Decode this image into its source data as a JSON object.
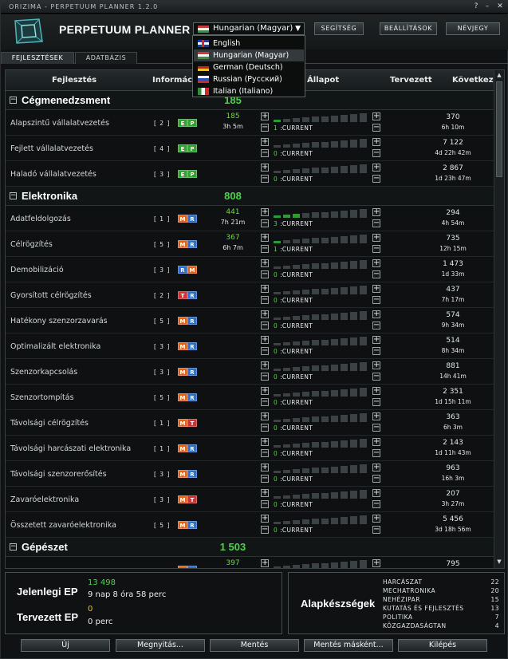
{
  "window": {
    "title": "ORIZIMA - PERPETUUM PLANNER 1.2.0",
    "help": "?",
    "minimize": "–",
    "close": "✕"
  },
  "app": {
    "title": "PERPETUUM PLANNER"
  },
  "language": {
    "selected": "Hungarian (Magyar)",
    "options": [
      "English",
      "Hungarian (Magyar)",
      "German (Deutsch)",
      "Russian (Русский)",
      "Italian (Italiano)"
    ]
  },
  "header_buttons": [
    "SEGÍTSÉG",
    "BEÁLLÍTÁSOK",
    "NÉVJEGY"
  ],
  "tabs": [
    "FEJLESZTÉSEK",
    "ADATBÁZIS"
  ],
  "columns": {
    "name": "Fejlesztés",
    "info": "Informác",
    "state": "Állapot",
    "planned": "Tervezett",
    "next": "Következő"
  },
  "categories": [
    {
      "name": "Cégmenedzsment",
      "ep": "185",
      "rows": [
        {
          "name": "Alapszintű vállalatvezetés",
          "level": "[ 2 ]",
          "badges": [
            "E",
            "P"
          ],
          "ep": "185",
          "eptime": "3h 5m",
          "current": "1",
          "current_label": ":CURRENT",
          "filled": 1,
          "next": "370",
          "next_time": "6h 10m"
        },
        {
          "name": "Fejlett vállalatvezetés",
          "level": "[ 4 ]",
          "badges": [
            "E",
            "P"
          ],
          "ep": "",
          "eptime": "",
          "current": "0",
          "current_label": ":CURRENT",
          "filled": 0,
          "next": "7 122",
          "next_time": "4d 22h 42m"
        },
        {
          "name": "Haladó vállalatvezetés",
          "level": "[ 3 ]",
          "badges": [
            "E",
            "P"
          ],
          "ep": "",
          "eptime": "",
          "current": "0",
          "current_label": ":CURRENT",
          "filled": 0,
          "next": "2 867",
          "next_time": "1d 23h 47m"
        }
      ]
    },
    {
      "name": "Elektronika",
      "ep": "808",
      "rows": [
        {
          "name": "Adatfeldolgozás",
          "level": "[ 1 ]",
          "badges": [
            "M",
            "R"
          ],
          "ep": "441",
          "eptime": "7h 21m",
          "current": "3",
          "current_label": ":CURRENT",
          "filled": 3,
          "next": "294",
          "next_time": "4h 54m"
        },
        {
          "name": "Célrögzítés",
          "level": "[ 5 ]",
          "badges": [
            "M",
            "R"
          ],
          "ep": "367",
          "eptime": "6h 7m",
          "current": "1",
          "current_label": ":CURRENT",
          "filled": 1,
          "next": "735",
          "next_time": "12h 15m"
        },
        {
          "name": "Demobilizáció",
          "level": "[ 3 ]",
          "badges": [
            "R",
            "M"
          ],
          "ep": "",
          "eptime": "",
          "current": "0",
          "current_label": ":CURRENT",
          "filled": 0,
          "next": "1 473",
          "next_time": "1d 33m"
        },
        {
          "name": "Gyorsított célrögzítés",
          "level": "[ 2 ]",
          "badges": [
            "T",
            "R"
          ],
          "ep": "",
          "eptime": "",
          "current": "0",
          "current_label": ":CURRENT",
          "filled": 0,
          "next": "437",
          "next_time": "7h 17m"
        },
        {
          "name": "Hatékony szenzorzavarás",
          "level": "[ 5 ]",
          "badges": [
            "M",
            "R"
          ],
          "ep": "",
          "eptime": "",
          "current": "0",
          "current_label": ":CURRENT",
          "filled": 0,
          "next": "574",
          "next_time": "9h 34m"
        },
        {
          "name": "Optimalizált elektronika",
          "level": "[ 3 ]",
          "badges": [
            "M",
            "R"
          ],
          "ep": "",
          "eptime": "",
          "current": "0",
          "current_label": ":CURRENT",
          "filled": 0,
          "next": "514",
          "next_time": "8h 34m"
        },
        {
          "name": "Szenzorkapcsolás",
          "level": "[ 3 ]",
          "badges": [
            "M",
            "R"
          ],
          "ep": "",
          "eptime": "",
          "current": "0",
          "current_label": ":CURRENT",
          "filled": 0,
          "next": "881",
          "next_time": "14h 41m"
        },
        {
          "name": "Szenzortompítás",
          "level": "[ 5 ]",
          "badges": [
            "M",
            "R"
          ],
          "ep": "",
          "eptime": "",
          "current": "0",
          "current_label": ":CURRENT",
          "filled": 0,
          "next": "2 351",
          "next_time": "1d 15h 11m"
        },
        {
          "name": "Távolsági célrögzítés",
          "level": "[ 1 ]",
          "badges": [
            "M",
            "T"
          ],
          "ep": "",
          "eptime": "",
          "current": "0",
          "current_label": ":CURRENT",
          "filled": 0,
          "next": "363",
          "next_time": "6h 3m"
        },
        {
          "name": "Távolsági harcászati elektronika",
          "level": "[ 1 ]",
          "badges": [
            "M",
            "R"
          ],
          "ep": "",
          "eptime": "",
          "current": "0",
          "current_label": ":CURRENT",
          "filled": 0,
          "next": "2 143",
          "next_time": "1d 11h 43m"
        },
        {
          "name": "Távolsági szenzorerősítés",
          "level": "[ 3 ]",
          "badges": [
            "M",
            "R"
          ],
          "ep": "",
          "eptime": "",
          "current": "0",
          "current_label": ":CURRENT",
          "filled": 0,
          "next": "963",
          "next_time": "16h 3m"
        },
        {
          "name": "Zavaróelektronika",
          "level": "[ 3 ]",
          "badges": [
            "M",
            "T"
          ],
          "ep": "",
          "eptime": "",
          "current": "0",
          "current_label": ":CURRENT",
          "filled": 0,
          "next": "207",
          "next_time": "3h 27m"
        },
        {
          "name": "Összetett zavaróelektronika",
          "level": "[ 5 ]",
          "badges": [
            "M",
            "R"
          ],
          "ep": "",
          "eptime": "",
          "current": "0",
          "current_label": ":CURRENT",
          "filled": 0,
          "next": "5 456",
          "next_time": "3d 18h 56m"
        }
      ]
    },
    {
      "name": "Gépészet",
      "ep": "1 503",
      "rows": [
        {
          "name": "",
          "level": "",
          "badges": [
            "M",
            "R"
          ],
          "ep": "397",
          "eptime": "",
          "current": "",
          "current_label": "",
          "filled": 0,
          "next": "795",
          "next_time": ""
        }
      ]
    }
  ],
  "badge_colors": {
    "E": "#2fa52f",
    "P": "#2fa52f",
    "M": "#e0641c",
    "R": "#2b6fcf",
    "T": "#d03232"
  },
  "summary": {
    "current_label": "Jelenlegi EP",
    "current_value": "13 498",
    "current_time": "9 nap 8 óra 58 perc",
    "planned_label": "Tervezett EP",
    "planned_value": "0",
    "planned_time": "0 perc"
  },
  "skills": {
    "title": "Alapkészségek",
    "items": [
      {
        "name": "HARCÁSZAT",
        "count": "22"
      },
      {
        "name": "MECHATRONIKA",
        "count": "20"
      },
      {
        "name": "NEHÉZIPAR",
        "count": "15"
      },
      {
        "name": "KUTATÁS ÉS FEJLESZTÉS",
        "count": "13"
      },
      {
        "name": "POLITIKA",
        "count": "7"
      },
      {
        "name": "KÖZGAZDASÁGTAN",
        "count": "4"
      }
    ]
  },
  "footer_buttons": [
    "Új",
    "Megnyitás...",
    "Mentés",
    "Mentés másként...",
    "Kilépés"
  ]
}
